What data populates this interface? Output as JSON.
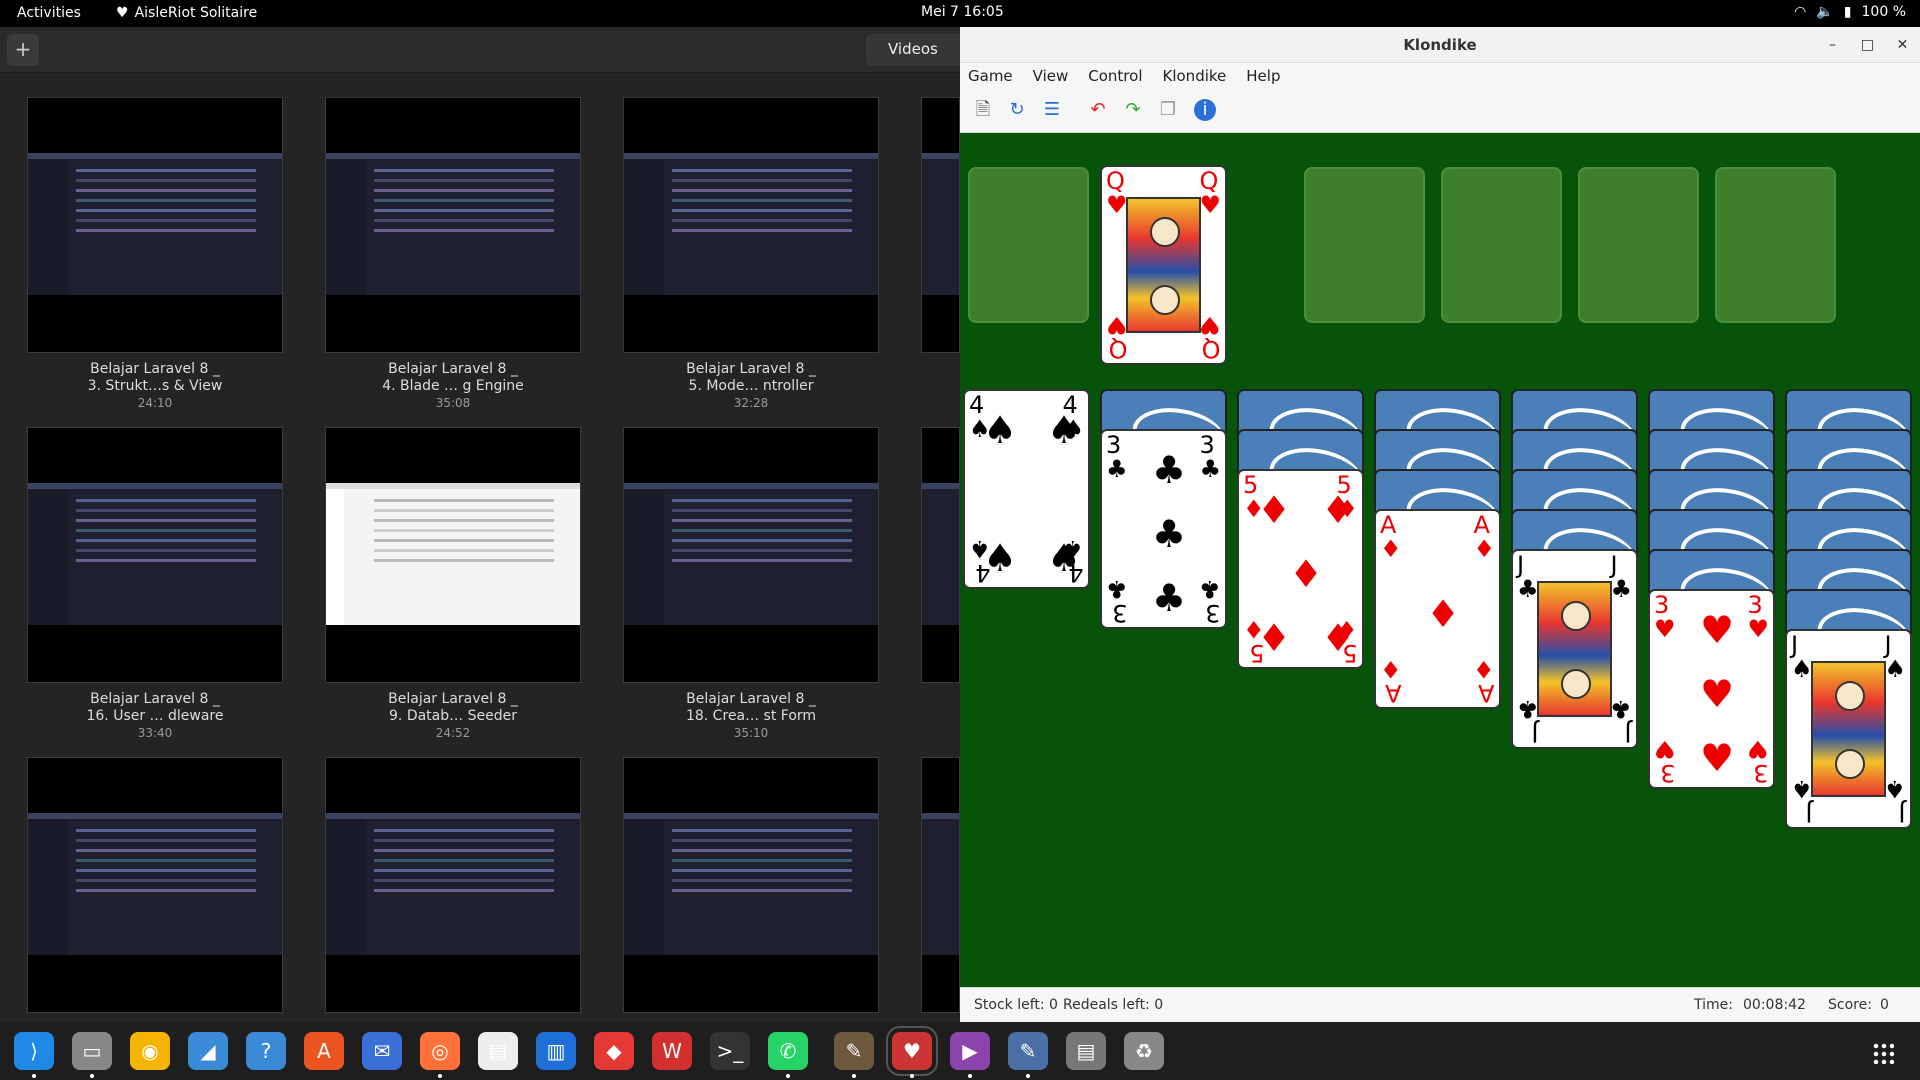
{
  "topbar": {
    "activities": "Activities",
    "app_name": "AisleRiot Solitaire",
    "clock": "Mei 7  16:05",
    "battery": "100 %"
  },
  "videos": {
    "add_label": "+",
    "tab_label": "Videos",
    "items": [
      {
        "title1": "Belajar Laravel 8 _",
        "title2": "3. Strukt…s & View",
        "duration": "24:10"
      },
      {
        "title1": "Belajar Laravel 8 _",
        "title2": "4. Blade … g Engine",
        "duration": "35:08"
      },
      {
        "title1": "Belajar Laravel 8 _",
        "title2": "5. Mode…  ntroller",
        "duration": "32:28"
      },
      {
        "title1": "Belajar Laravel 8 _",
        "title2": "16. User … dleware",
        "duration": "33:40"
      },
      {
        "title1": "Belajar Laravel 8 _",
        "title2": "9. Datab…  Seeder",
        "duration": "24:52"
      },
      {
        "title1": "Belajar Laravel 8 _",
        "title2": "18. Crea…  st Form",
        "duration": "35:10"
      }
    ]
  },
  "solitaire": {
    "window_title": "Klondike",
    "menu": [
      "Game",
      "View",
      "Control",
      "Klondike",
      "Help"
    ],
    "toolbar_icons": [
      "new-game-icon",
      "restart-icon",
      "select-game-icon",
      "undo-icon",
      "redo-icon",
      "hint-icon",
      "info-icon"
    ],
    "waste_card": {
      "rank": "Q",
      "suit": "♥"
    },
    "tableau": [
      {
        "face_down": 0,
        "cards": [
          {
            "rank": "4",
            "suit": "♠"
          }
        ]
      },
      {
        "face_down": 1,
        "cards": [
          {
            "rank": "3",
            "suit": "♣"
          }
        ]
      },
      {
        "face_down": 2,
        "cards": [
          {
            "rank": "5",
            "suit": "♦"
          }
        ]
      },
      {
        "face_down": 3,
        "cards": [
          {
            "rank": "A",
            "suit": "♦"
          }
        ]
      },
      {
        "face_down": 4,
        "cards": [
          {
            "rank": "J",
            "suit": "♣"
          }
        ]
      },
      {
        "face_down": 5,
        "cards": [
          {
            "rank": "3",
            "suit": "♥"
          }
        ]
      },
      {
        "face_down": 6,
        "cards": [
          {
            "rank": "J",
            "suit": "♠"
          }
        ]
      }
    ],
    "status": {
      "stock": "Stock left: 0",
      "redeals": "Redeals left: 0",
      "time_label": "Time:",
      "time": "00:08:42",
      "score_label": "Score:",
      "score": "0"
    },
    "felt_color": "#05540a"
  },
  "dock": {
    "apps": [
      "vscode-icon",
      "files-icon",
      "rhythmbox-icon",
      "dolphin-icon",
      "help-icon",
      "software-icon",
      "thunderbird-icon",
      "firefox-icon",
      "document-scanner-icon",
      "writer-icon",
      "anydesk-icon",
      "wps-icon",
      "terminal-icon",
      "whatsapp-icon",
      "gimp-icon",
      "solitaire-icon",
      "video-icon",
      "text-editor-icon",
      "document-icon",
      "trash-icon",
      "show-apps-icon"
    ]
  }
}
